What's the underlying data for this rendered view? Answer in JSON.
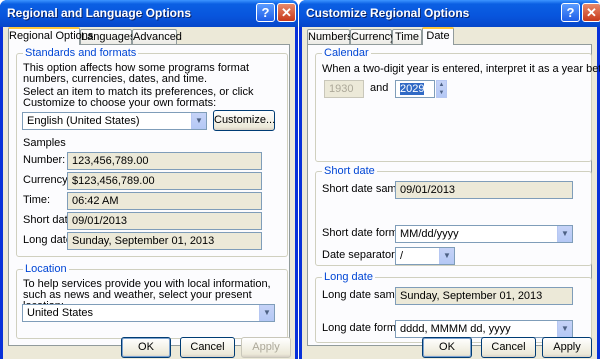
{
  "left_window": {
    "title": "Regional and Language Options",
    "tabs": [
      "Regional Options",
      "Languages",
      "Advanced"
    ],
    "standards": {
      "group_label": "Standards and formats",
      "description": "This option affects how some programs format numbers, currencies, dates, and time.",
      "select_prompt": "Select an item to match its preferences, or click Customize to choose your own formats:",
      "locale": "English (United States)",
      "customize_label": "Customize...",
      "samples_label": "Samples",
      "samples": [
        {
          "label": "Number:",
          "value": "123,456,789.00"
        },
        {
          "label": "Currency:",
          "value": "$123,456,789.00"
        },
        {
          "label": "Time:",
          "value": "06:42 AM"
        },
        {
          "label": "Short date:",
          "value": "09/01/2013"
        },
        {
          "label": "Long date:",
          "value": "Sunday, September 01, 2013"
        }
      ]
    },
    "location": {
      "group_label": "Location",
      "description": "To help services provide you with local information, such as news and weather, select your present location:",
      "value": "United States"
    },
    "buttons": {
      "ok": "OK",
      "cancel": "Cancel",
      "apply": "Apply"
    }
  },
  "right_window": {
    "title": "Customize Regional Options",
    "tabs": [
      "Numbers",
      "Currency",
      "Time",
      "Date"
    ],
    "calendar": {
      "group_label": "Calendar",
      "description": "When a two-digit year is entered, interpret it as a year between:",
      "from_year": "1930",
      "and_label": "and",
      "to_year": "2029"
    },
    "short_date": {
      "group_label": "Short date",
      "sample_label": "Short date sample:",
      "sample": "09/01/2013",
      "format_label": "Short date format:",
      "format": "MM/dd/yyyy",
      "separator_label": "Date separator:",
      "separator": "/"
    },
    "long_date": {
      "group_label": "Long date",
      "sample_label": "Long date sample:",
      "sample": "Sunday, September 01, 2013",
      "format_label": "Long date format:",
      "format": "dddd, MMMM dd, yyyy"
    },
    "buttons": {
      "ok": "OK",
      "cancel": "Cancel",
      "apply": "Apply"
    }
  },
  "colors": {
    "titlebar": "#0a5fe3",
    "group_label": "#0046d5",
    "face": "#ece9d8",
    "tab_highlight": "#ffc83c"
  }
}
